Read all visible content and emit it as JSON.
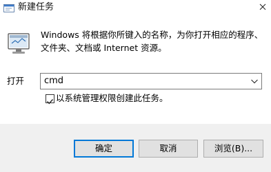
{
  "window": {
    "title": "新建任务",
    "icons": {
      "app": "run-dialog-icon",
      "close": "close-icon",
      "main": "run-computer-icon"
    }
  },
  "dialog": {
    "description_line1": "Windows 将根据你所键入的名称，为你打开相应的程序、",
    "description_line2": "文件夹、文档或 Internet 资源。",
    "open_label": "打开",
    "open_value": "cmd",
    "checkbox": {
      "label": "以系统管理权限创建此任务。",
      "checked": true
    }
  },
  "buttons": {
    "ok": "确定",
    "cancel": "取消",
    "browse": "浏览(B)..."
  },
  "colors": {
    "accent": "#0078d7",
    "footer_bg": "#f0f0f0",
    "button_bg": "#e1e1e1"
  }
}
